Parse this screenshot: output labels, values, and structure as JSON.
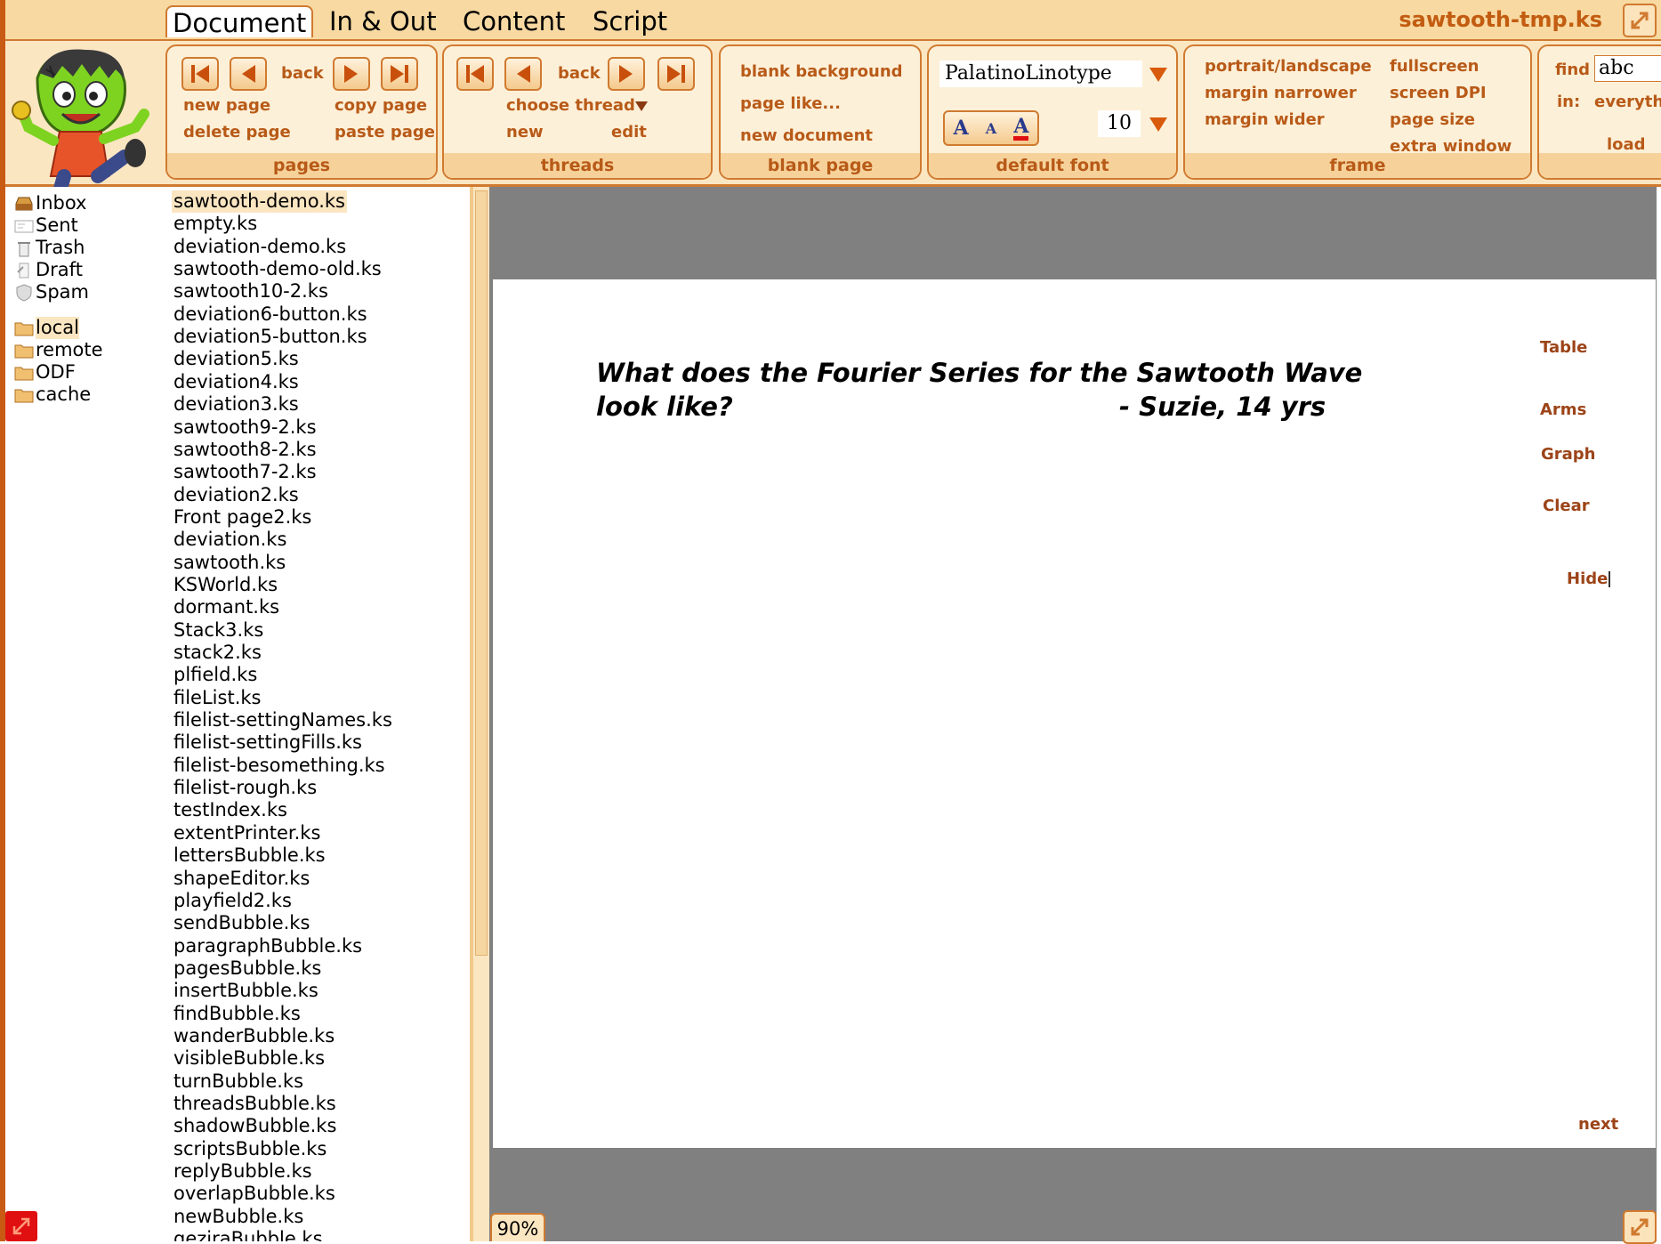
{
  "menu": {
    "tabs": [
      {
        "label": "Document",
        "active": true
      },
      {
        "label": "In & Out",
        "active": false
      },
      {
        "label": "Content",
        "active": false
      },
      {
        "label": "Script",
        "active": false
      }
    ],
    "document_title": "sawtooth-tmp.ks"
  },
  "toolbar": {
    "pages": {
      "title": "pages",
      "back_label": "back",
      "new_page": "new page",
      "copy_page": "copy page",
      "delete_page": "delete page",
      "paste_page": "paste page"
    },
    "threads": {
      "title": "threads",
      "back_label": "back",
      "choose_thread": "choose thread",
      "new": "new",
      "edit": "edit"
    },
    "blank_page": {
      "title": "blank page",
      "blank_background": "blank background",
      "page_like": "page like...",
      "new_document": "new document"
    },
    "default_font": {
      "title": "default font",
      "font_name": "PalatinoLinotype",
      "font_size": "10",
      "font_buttons": [
        "A",
        "A",
        "A"
      ]
    },
    "frame": {
      "title": "frame",
      "portrait_landscape": "portrait/landscape",
      "margin_narrower": "margin narrower",
      "margin_wider": "margin wider",
      "fullscreen": "fullscreen",
      "screen_dpi": "screen DPI",
      "page_size": "page size",
      "extra_window": "extra window"
    },
    "find": {
      "find_label": "find",
      "find_value": "abc",
      "in_label": "in:",
      "in_value": "everyth",
      "load": "load"
    }
  },
  "folders": [
    {
      "label": "Inbox",
      "icon": "inbox-icon"
    },
    {
      "label": "Sent",
      "icon": "sent-icon"
    },
    {
      "label": "Trash",
      "icon": "trash-icon"
    },
    {
      "label": "Draft",
      "icon": "draft-icon"
    },
    {
      "label": "Spam",
      "icon": "spam-icon"
    },
    {
      "label": "local",
      "icon": "folder-icon",
      "selected": true
    },
    {
      "label": "remote",
      "icon": "folder-icon"
    },
    {
      "label": "ODF",
      "icon": "folder-icon"
    },
    {
      "label": "cache",
      "icon": "folder-icon"
    }
  ],
  "files": [
    "sawtooth-demo.ks",
    "empty.ks",
    "deviation-demo.ks",
    "sawtooth-demo-old.ks",
    "sawtooth10-2.ks",
    "deviation6-button.ks",
    "deviation5-button.ks",
    "deviation5.ks",
    "deviation4.ks",
    "deviation3.ks",
    "sawtooth9-2.ks",
    "sawtooth8-2.ks",
    "sawtooth7-2.ks",
    "deviation2.ks",
    "Front page2.ks",
    "deviation.ks",
    "sawtooth.ks",
    "KSWorld.ks",
    "dormant.ks",
    "Stack3.ks",
    "stack2.ks",
    "plfield.ks",
    "fileList.ks",
    "filelist-settingNames.ks",
    "filelist-settingFills.ks",
    "filelist-besomething.ks",
    "filelist-rough.ks",
    "testIndex.ks",
    "extentPrinter.ks",
    "lettersBubble.ks",
    "shapeEditor.ks",
    "playfield2.ks",
    "sendBubble.ks",
    "paragraphBubble.ks",
    "pagesBubble.ks",
    "insertBubble.ks",
    "findBubble.ks",
    "wanderBubble.ks",
    "visibleBubble.ks",
    "turnBubble.ks",
    "threadsBubble.ks",
    "shadowBubble.ks",
    "scriptsBubble.ks",
    "replyBubble.ks",
    "overlapBubble.ks",
    "newBubble.ks",
    "geziraBubble.ks"
  ],
  "selected_file": "sawtooth-demo.ks",
  "page": {
    "question_line1": "What does the Fourier Series for the Sawtooth Wave",
    "question_line2": "look like?",
    "author": "- Suzie, 14 yrs",
    "side_links": {
      "table": "Table",
      "arms": "Arms",
      "graph": "Graph",
      "clear": "Clear",
      "hide": "Hide",
      "next": "next"
    }
  },
  "zoom": "90%",
  "colors": {
    "accent": "#d07a30",
    "toolbar_bg": "#fbe6c2",
    "link_text": "#b85a18",
    "canvas_bg": "#808080"
  }
}
